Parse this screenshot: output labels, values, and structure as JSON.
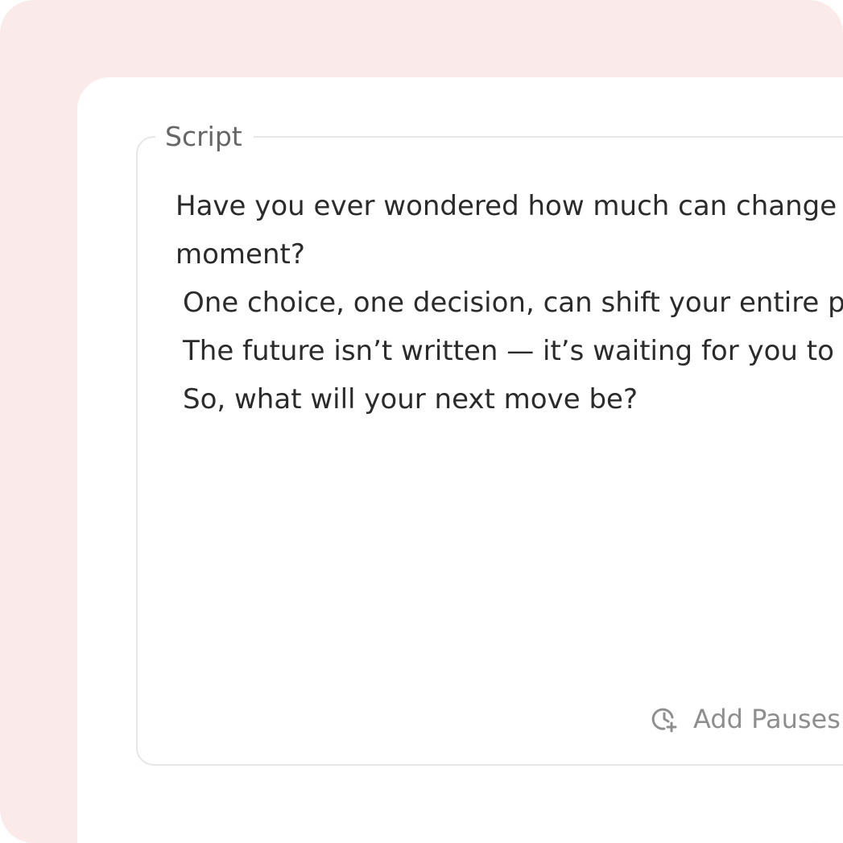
{
  "script_panel": {
    "legend": "Script",
    "lines": [
      "Have you ever wondered how much can change in a single",
      "moment?",
      "One choice, one decision, can shift your entire path.",
      "The future isn’t written — it’s waiting for you to shape it.",
      "So, what will your next move be?"
    ],
    "add_pauses_label": "Add Pauses",
    "add_pauses_icon": "clock-plus-icon"
  },
  "colors": {
    "frame_background": "#fbeaea",
    "card_background": "#ffffff",
    "border": "#e6e6e6",
    "text": "#2b2b2b",
    "muted_text": "#8e8e8e"
  }
}
